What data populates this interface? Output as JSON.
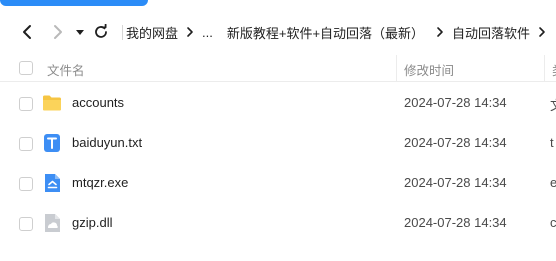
{
  "toolbar": {
    "back_icon": "chevron-left-icon",
    "forward_icon": "chevron-right-icon",
    "dropdown_icon": "caret-down-icon",
    "refresh_icon": "refresh-icon"
  },
  "breadcrumb": {
    "root": "我的网盘",
    "ellipsis": "...",
    "folder1": "新版教程+软件+自动回落（最新）",
    "folder2": "自动回落软件"
  },
  "table": {
    "col_name": "文件名",
    "col_modified": "修改时间",
    "col_next_cut": "类",
    "rows": [
      {
        "name": "accounts",
        "modified": "2024-07-28 14:34",
        "icon": "folder-icon",
        "cut": "文"
      },
      {
        "name": "baiduyun.txt",
        "modified": "2024-07-28 14:34",
        "icon": "text-file-icon",
        "cut": "t"
      },
      {
        "name": "mtqzr.exe",
        "modified": "2024-07-28 14:34",
        "icon": "exe-file-icon",
        "cut": "e"
      },
      {
        "name": "gzip.dll",
        "modified": "2024-07-28 14:34",
        "icon": "dll-file-icon",
        "cut": "c"
      }
    ]
  },
  "colors": {
    "accent": "#2b8cf7",
    "folder": "#f6c543",
    "txt_icon": "#3d8ef4",
    "dll_icon": "#c9ccd1"
  }
}
